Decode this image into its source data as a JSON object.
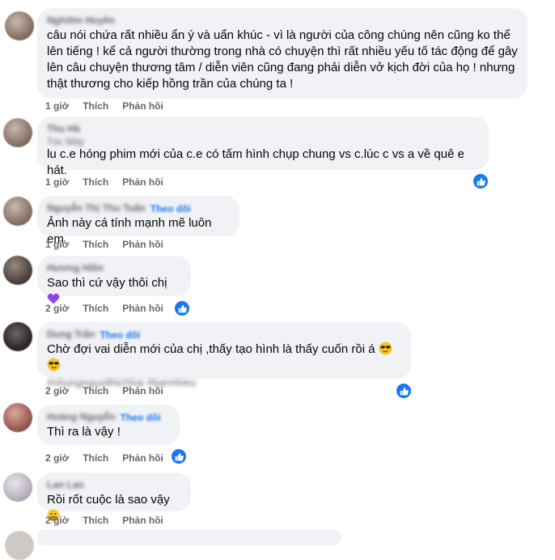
{
  "comments": [
    {
      "author": "Nghiêm Huyền",
      "text": "câu nói chứa rất nhiều ẩn ý và uẩn khúc - vì là người của công chúng nên cũng ko thể lên tiếng ! kể cả người thường trong nhà có chuyện thì rất nhiều yếu tố tác động để gây lên câu chuyện thương tâm / diễn viên cũng đang phải diễn vở kịch đời của họ ! nhưng thật thương cho kiếp hồng trần của chúng ta !",
      "time": "1 giờ",
      "like": "Thích",
      "reply": "Phản hồi"
    },
    {
      "author": "Thu Hà",
      "sub": "Tóc Mây",
      "text": "lu c.e hóng phim mới của c.e có tấm hình chụp chung vs c.lúc c vs a về quê e hát.",
      "time": "1 giờ",
      "like": "Thích",
      "reply": "Phản hồi"
    },
    {
      "author": "Nguyễn Thị Thu Tuấn",
      "follow": "Theo dõi",
      "text": "Ảnh này cá tính mạnh mẽ luôn em",
      "time": "1 giờ",
      "like": "Thích",
      "reply": "Phản hồi"
    },
    {
      "author": "Hương Hiền",
      "text": "Sao thì cứ vậy thôi chị",
      "time": "2 giờ",
      "like": "Thích",
      "reply": "Phản hồi"
    },
    {
      "author": "Dung Trần",
      "follow": "Theo dõi",
      "text": "Chờ đợi vai diễn mới của chị ,thấy tạo hình là thấy cuốn rồi á",
      "sub": "#nhungnguoithichhai #bannhieu",
      "time": "2 giờ",
      "like": "Thích",
      "reply": "Phản hồi"
    },
    {
      "author": "Hoàng Nguyễn",
      "follow": "Theo dõi",
      "text": "Thì ra là vậy !",
      "time": "2 giờ",
      "like": "Thích",
      "reply": "Phản hồi"
    },
    {
      "author": "Lan Lan",
      "text": "Rồi rốt cuộc là sao vậy",
      "time": "2 giờ",
      "like": "Thích",
      "reply": "Phản hồi"
    }
  ],
  "colors": {
    "bubble": "#f0f2f5",
    "accent": "#1877f2",
    "meta": "#65676b",
    "text": "#050505"
  }
}
